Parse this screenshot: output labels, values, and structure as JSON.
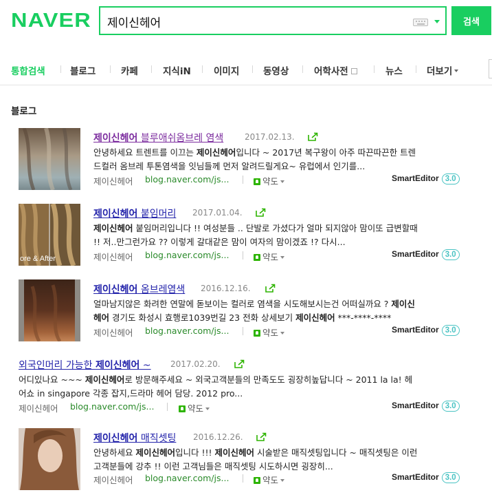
{
  "header": {
    "logo": "NAVER",
    "search_value": "제이신헤어",
    "search_button": "검색",
    "brand_color": "#19ce60"
  },
  "tabs": [
    {
      "label": "통합검색",
      "active": true
    },
    {
      "label": "블로그"
    },
    {
      "label": "카페"
    },
    {
      "label": "지식iN"
    },
    {
      "label": "이미지"
    },
    {
      "label": "동영상"
    },
    {
      "label": "어학사전"
    },
    {
      "label": "뉴스"
    },
    {
      "label": "더보기"
    }
  ],
  "section_title": "블로그",
  "results": [
    {
      "title_pre": "",
      "title_bold": "제이신헤어",
      "title_post": " 블루애쉬옴브레 염색",
      "visited": true,
      "date": "2017.02.13.",
      "desc1": {
        "pre": "안녕하세요 트렌트를 이끄는 ",
        "bold": "제이신헤어",
        "post": "입니다 ~ 2017년 복구왕이 아주 따끈따끈한 트렌"
      },
      "desc2": "드컬러 옴브레 투톤염색을 잇님들께 먼저 알려드릴게요~ 유럽에서 인기를...",
      "author": "제이신헤어",
      "url": "blog.naver.com/js...",
      "map_label": "약도",
      "editor": "SmartEditor",
      "editor_version": "3.0",
      "thumb": "ombre-ash"
    },
    {
      "title_pre": "",
      "title_bold": "제이신헤어",
      "title_post": " 붙임머리",
      "visited": false,
      "date": "2017.01.04.",
      "desc1": {
        "pre": "",
        "bold": "제이신헤어",
        "post": " 붙임머리입니다 !! 여성분들 .. 단발로 가셨다가 얼마 되지않아 맘이또 급변할때"
      },
      "desc2": "!! 저..만그런가요 ?? 이렇게 갈대같은 맘이 여자의 맘이겠죠 !? 다시...",
      "author": "제이신헤어",
      "url": "blog.naver.com/js...",
      "map_label": "약도",
      "editor": "SmartEditor",
      "editor_version": "3.0",
      "thumb": "extension",
      "thumb_text": "ore & After"
    },
    {
      "title_pre": "",
      "title_bold": "제이신헤어",
      "title_post": " 옴브레염색",
      "visited": false,
      "date": "2016.12.16.",
      "desc1": {
        "pre": "얼마남지않은 화려한 연말에 돋보이는 컬러로 염색을 시도해보시는건 어떠실까요 ? ",
        "bold": "제이신",
        "post": ""
      },
      "desc2_parts": {
        "bold1": "헤어",
        "mid": " 경기도 화성시 효행로1039번길 23 전화 상세보기 ",
        "bold2": "제이신헤어",
        "post": " ***-****-****"
      },
      "author": "제이신헤어",
      "url": "blog.naver.com/js...",
      "map_label": "약도",
      "editor": "SmartEditor",
      "editor_version": "3.0",
      "thumb": "ombre-brown"
    },
    {
      "title_pre": "외국인머리 가능한 ",
      "title_bold": "제이신헤어",
      "title_post": " ~",
      "visited": false,
      "date": "2017.02.20.",
      "desc1": {
        "pre": "어디있나요 ~~~ ",
        "bold": "제이신헤어",
        "post": "로 방문해주세요 ~ 외국고객분들의 만족도도 굉장히높답니다 ~ 2011 la la! 헤"
      },
      "desc2": "어쇼 in singapore 각종 잡지,드라마 헤어 담당. 2012 pro...",
      "author": "제이신헤어",
      "url": "blog.naver.com/js...",
      "map_label": "약도",
      "editor": "SmartEditor",
      "editor_version": "3.0"
    },
    {
      "title_pre": "",
      "title_bold": "제이신헤어",
      "title_post": " 매직셋팅",
      "visited": false,
      "date": "2016.12.26.",
      "desc1": {
        "pre": "안녕하세요 ",
        "bold": "제이신헤어",
        "post": "입니다 !!! ",
        "bold2": "제이신헤어",
        "post2": " 시술받은 매직셋팅입니다 ~ 매직셋팅은 이런"
      },
      "desc2": "고객분들에 강추 !! 이런 고객님들은 매직셋팅 시도하시면 굉장히...",
      "author": "제이신헤어",
      "url": "blog.naver.com/js...",
      "map_label": "약도",
      "editor": "SmartEditor",
      "editor_version": "3.0",
      "thumb": "magic-setting"
    }
  ]
}
